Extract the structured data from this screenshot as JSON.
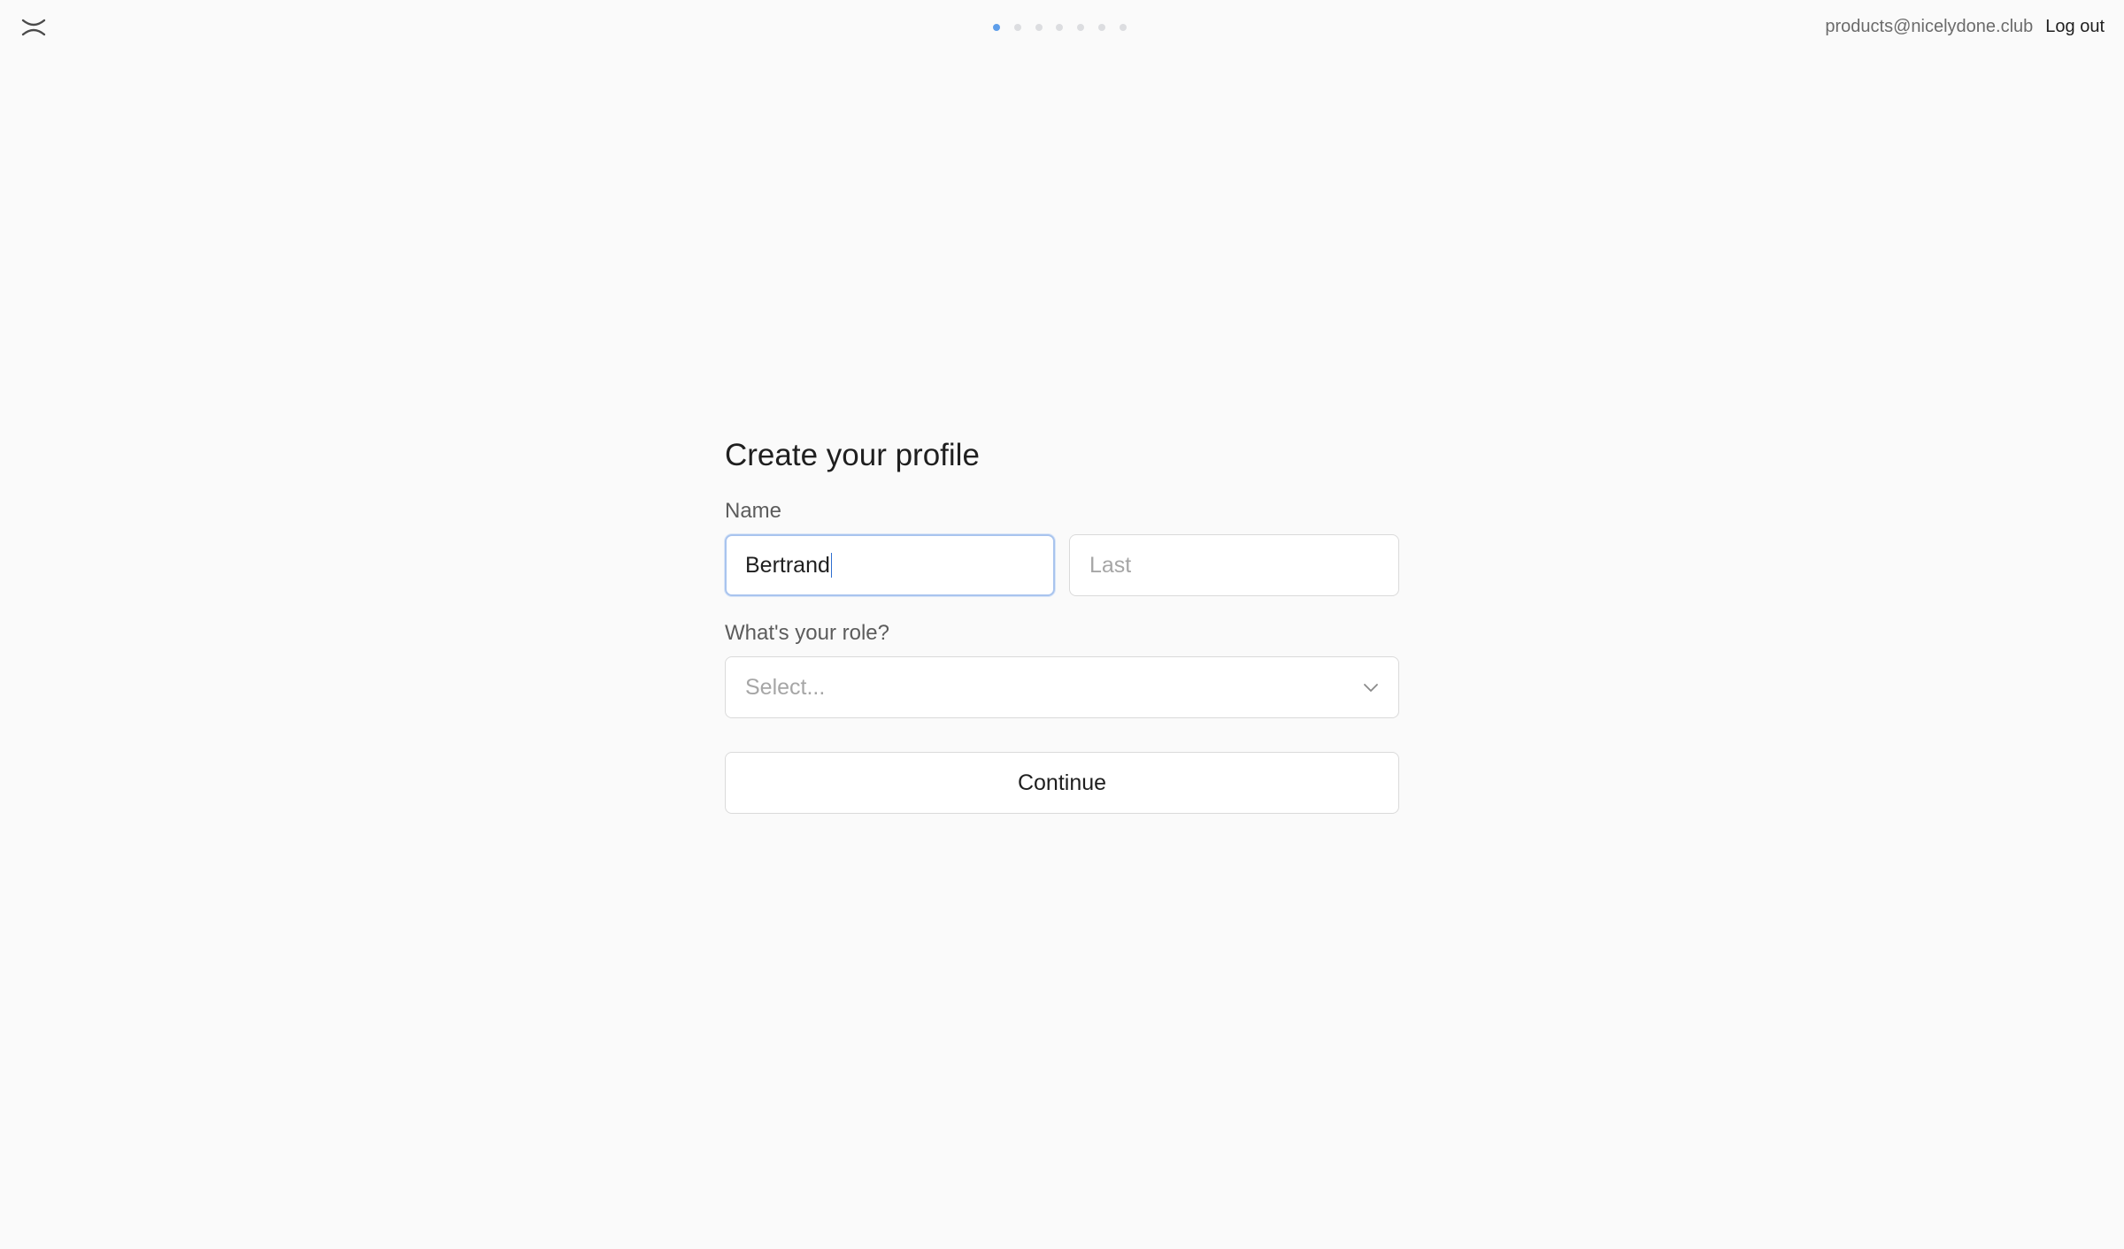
{
  "header": {
    "logo_icon": "collapse-x-icon",
    "progress": {
      "total_steps": 7,
      "current_step": 1,
      "active_color": "#5e9eea",
      "inactive_color": "#dcdde0"
    },
    "account_email": "products@nicelydone.club",
    "logout_label": "Log out"
  },
  "form": {
    "title": "Create your profile",
    "name_label": "Name",
    "first_name_value": "Bertrand",
    "last_name_placeholder": "Last",
    "role_label": "What's your role?",
    "role_placeholder": "Select...",
    "role_chevron_icon": "chevron-down-icon",
    "continue_label": "Continue"
  }
}
